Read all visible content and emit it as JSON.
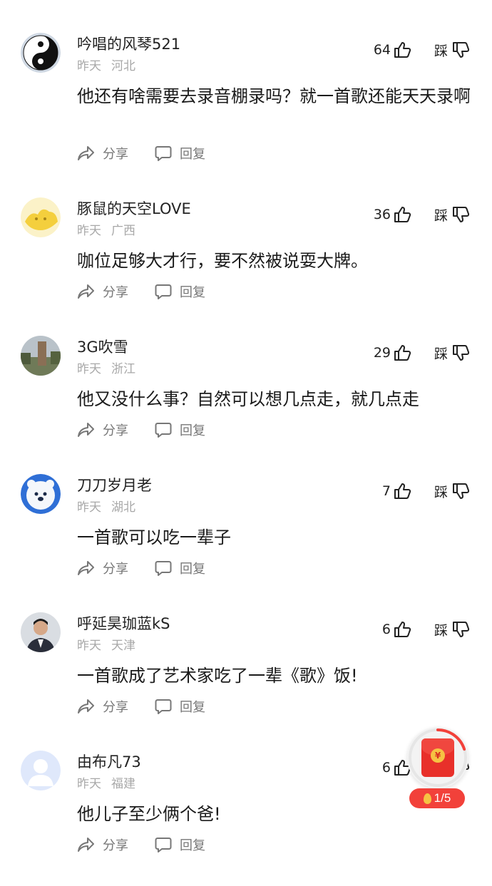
{
  "labels": {
    "share": "分享",
    "reply": "回复",
    "dislike": "踩"
  },
  "comments": [
    {
      "username": "吟唱的风琴521",
      "time": "昨天",
      "region": "河北",
      "likes": "64",
      "content": "他还有啥需要去录音棚录吗？就一首歌还能天天录啊",
      "avatar": "yin-yang"
    },
    {
      "username": "豚鼠的天空LOVE",
      "time": "昨天",
      "region": "广西",
      "likes": "36",
      "content": "咖位足够大才行，要不然被说耍大牌。",
      "avatar": "yellow-blob"
    },
    {
      "username": "3G吹雪",
      "time": "昨天",
      "region": "浙江",
      "likes": "29",
      "content": "他又没什么事？自然可以想几点走，就几点走",
      "avatar": "monument-photo"
    },
    {
      "username": "刀刀岁月老",
      "time": "昨天",
      "region": "湖北",
      "likes": "7",
      "content": "一首歌可以吃一辈子",
      "avatar": "bear-astronaut"
    },
    {
      "username": "呼延昊珈蓝kS",
      "time": "昨天",
      "region": "天津",
      "likes": "6",
      "content": "一首歌成了艺术家吃了一辈《歌》饭!",
      "avatar": "man-in-suit"
    },
    {
      "username": "由布凡73",
      "time": "昨天",
      "region": "福建",
      "likes": "6",
      "content": "他儿子至少俩个爸!",
      "avatar": "default-user"
    }
  ],
  "reward_widget": {
    "progress": "1/5",
    "envelope_symbol": "¥",
    "progress_fraction": 0.2
  },
  "colors": {
    "text": "#1a1a1a",
    "muted": "#a8a8a8",
    "action": "#777777",
    "accent_red": "#f2413a"
  }
}
